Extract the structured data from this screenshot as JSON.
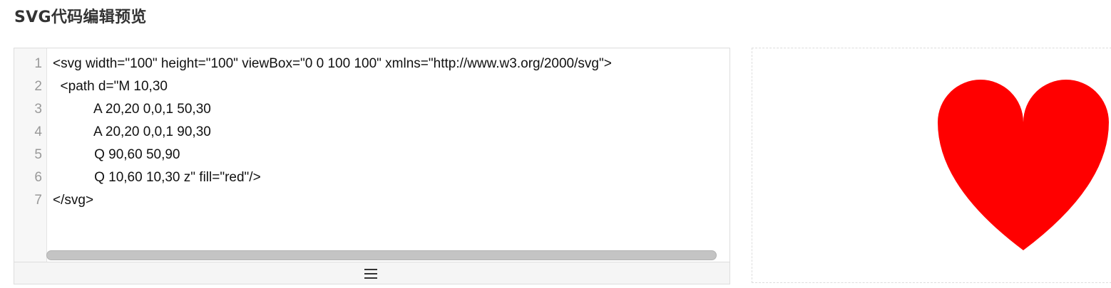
{
  "page": {
    "title": "SVG代码编辑预览"
  },
  "editor": {
    "line_numbers": [
      "1",
      "2",
      "3",
      "4",
      "5",
      "6",
      "7"
    ],
    "lines": [
      "<svg width=\"100\" height=\"100\" viewBox=\"0 0 100 100\" xmlns=\"http://www.w3.org/2000/svg\">",
      "  <path d=\"M 10,30",
      "           A 20,20 0,0,1 50,30",
      "           A 20,20 0,0,1 90,30",
      "           Q 90,60 50,90",
      "           Q 10,60 10,30 z\" fill=\"red\"/>",
      "</svg>"
    ],
    "resize_icon": "menu-icon"
  },
  "preview": {
    "shape": "heart",
    "fill_color": "#ff0000"
  }
}
